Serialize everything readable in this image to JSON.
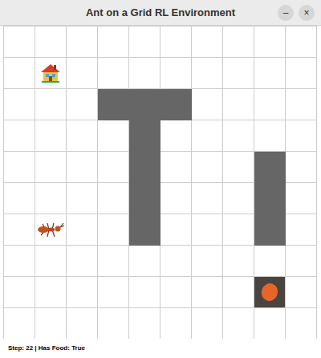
{
  "window": {
    "title": "Ant on a Grid RL Environment",
    "buttons": [
      "–",
      "×"
    ]
  },
  "grid": {
    "cells": [
      [
        "empty",
        "empty",
        "empty",
        "empty",
        "empty",
        "empty",
        "empty",
        "empty",
        "empty",
        "empty"
      ],
      [
        "empty",
        "home",
        "empty",
        "empty",
        "empty",
        "empty",
        "empty",
        "empty",
        "empty",
        "empty"
      ],
      [
        "empty",
        "empty",
        "empty",
        "wall",
        "wall",
        "wall",
        "empty",
        "empty",
        "empty",
        "empty"
      ],
      [
        "empty",
        "empty",
        "empty",
        "empty",
        "wall",
        "empty",
        "empty",
        "empty",
        "empty",
        "empty"
      ],
      [
        "empty",
        "empty",
        "empty",
        "empty",
        "wall",
        "empty",
        "empty",
        "empty",
        "wall",
        "empty"
      ],
      [
        "empty",
        "empty",
        "empty",
        "empty",
        "wall",
        "empty",
        "empty",
        "empty",
        "wall",
        "empty"
      ],
      [
        "empty",
        "ant",
        "empty",
        "empty",
        "wall",
        "empty",
        "empty",
        "empty",
        "wall",
        "empty"
      ],
      [
        "empty",
        "empty",
        "empty",
        "empty",
        "empty",
        "empty",
        "empty",
        "empty",
        "empty",
        "empty"
      ],
      [
        "empty",
        "empty",
        "empty",
        "empty",
        "empty",
        "empty",
        "empty",
        "empty",
        "food",
        "empty"
      ],
      [
        "empty",
        "empty",
        "empty",
        "empty",
        "empty",
        "empty",
        "empty",
        "empty",
        "empty",
        "empty"
      ]
    ]
  },
  "status_bar": "Step: 22 | Has Food: True"
}
